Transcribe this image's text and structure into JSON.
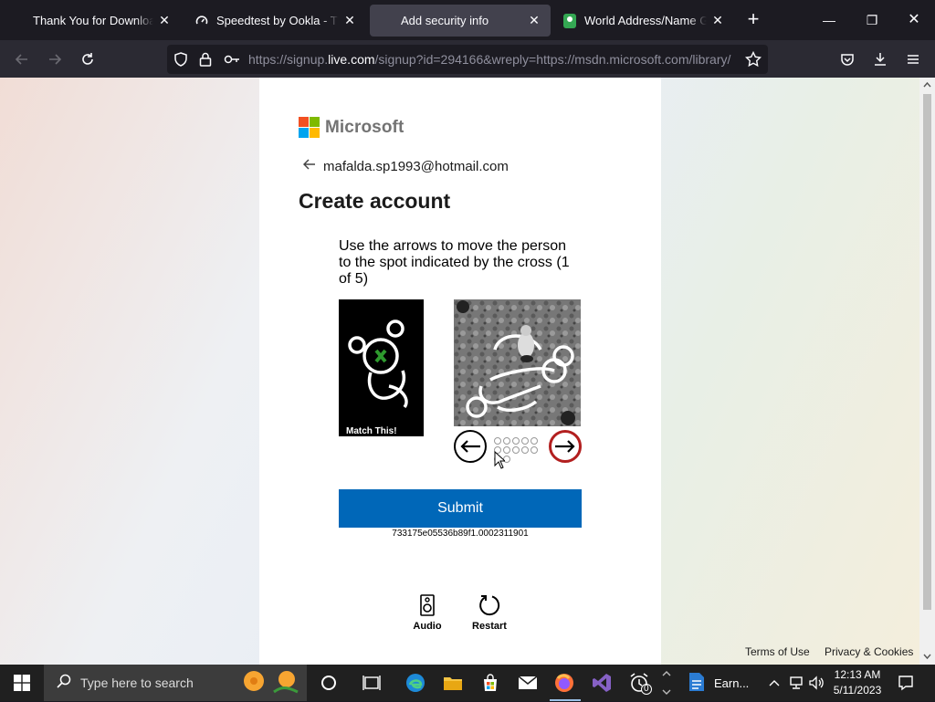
{
  "browser": {
    "tabs": [
      {
        "title": "Thank You for Downloading",
        "favicon": "microsoft-logo"
      },
      {
        "title": "Speedtest by Ookla - The Global",
        "favicon": "speedtest-icon"
      },
      {
        "title": "Add security info",
        "favicon": "microsoft-logo",
        "active": true
      },
      {
        "title": "World Address/Name Generator",
        "favicon": "map-pin-icon"
      }
    ],
    "url_prefix": "https://signup.",
    "url_domain": "live.com",
    "url_rest": "/signup?id=294166&wreply=https://msdn.microsoft.com/library/"
  },
  "page": {
    "brand_name": "Microsoft",
    "email": "mafalda.sp1993@hotmail.com",
    "title": "Create account",
    "captcha": {
      "instruction": "Use the arrows to move the person to the spot indicated by the cross (1 of 5)",
      "match_label": "Match This!",
      "submit_label": "Submit",
      "session_id": "733175e05536b89f1.0002311901",
      "audio_label": "Audio",
      "restart_label": "Restart"
    },
    "footer": {
      "terms": "Terms of Use",
      "privacy": "Privacy & Cookies"
    }
  },
  "taskbar": {
    "search_placeholder": "Type here to search",
    "open_app_label": "Earn...",
    "clock_time": "12:13 AM",
    "clock_date": "5/11/2023",
    "badge_count": "0"
  },
  "colors": {
    "accent": "#0067b8",
    "ms_red": "#f25022",
    "ms_green": "#7fba00",
    "ms_blue": "#00a4ef",
    "ms_yellow": "#ffb900"
  }
}
